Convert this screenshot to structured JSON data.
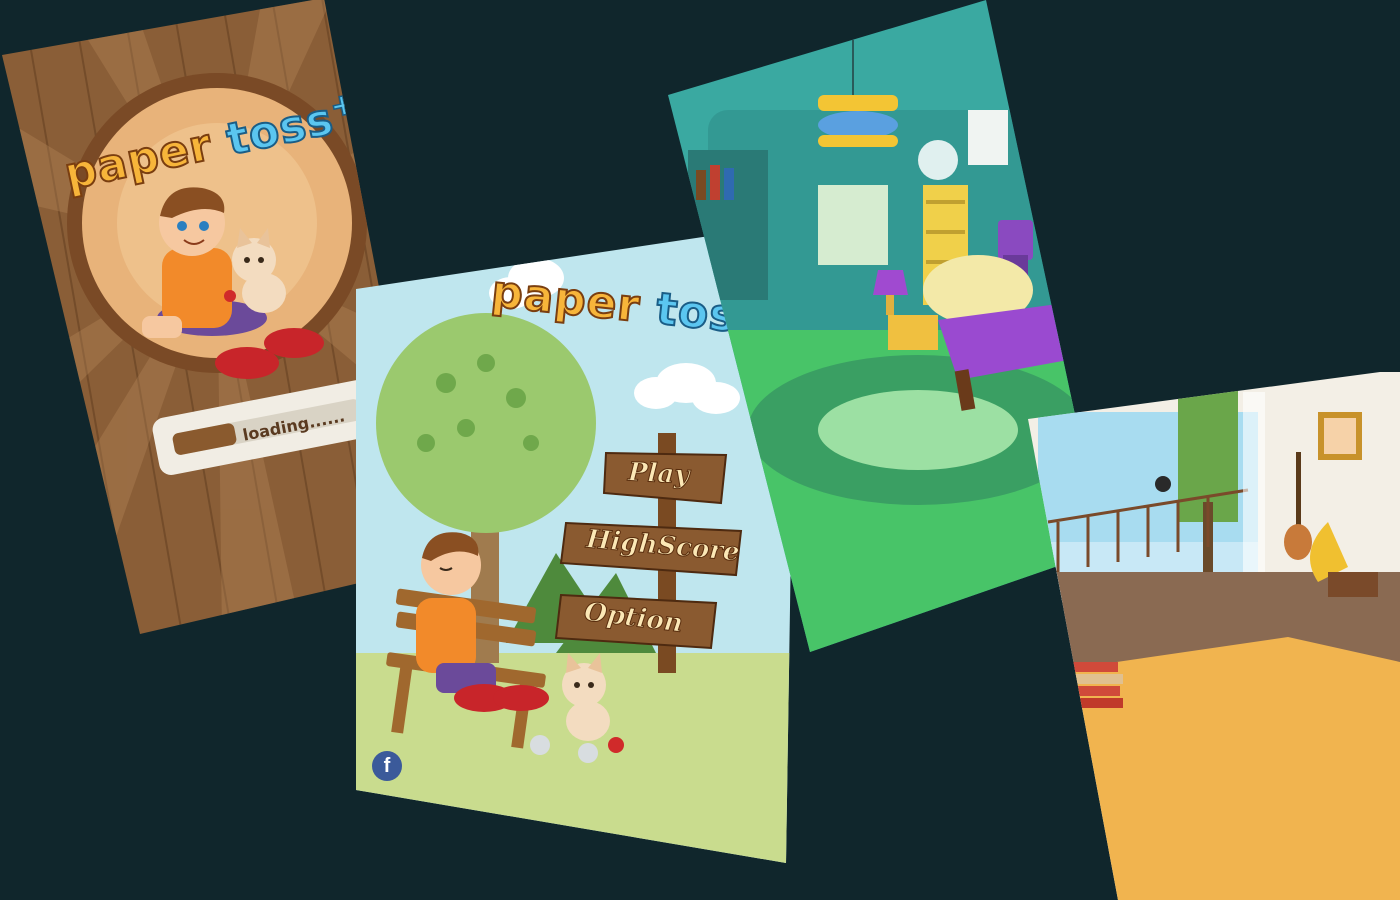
{
  "game": {
    "logo": {
      "word1": "paper",
      "word2": "toss",
      "plus": "+"
    },
    "loading_screen": {
      "loading_text": "loading......",
      "progress_fraction": 0.33
    },
    "menu_screen": {
      "buttons": {
        "play": "Play",
        "highscore": "HighScore",
        "option": "Option"
      },
      "facebook_icon_glyph": "f"
    },
    "scenes": [
      "bedroom",
      "living-room"
    ],
    "colors": {
      "background": "#10262c",
      "wood_light": "#9a6c40",
      "wood_dark": "#6e4628",
      "sky": "#bfe6ee",
      "grass": "#c9dc8e",
      "bedroom_wall": "#3aa9a1",
      "bedroom_floor": "#48c468",
      "rug": "#f1b44f"
    }
  }
}
